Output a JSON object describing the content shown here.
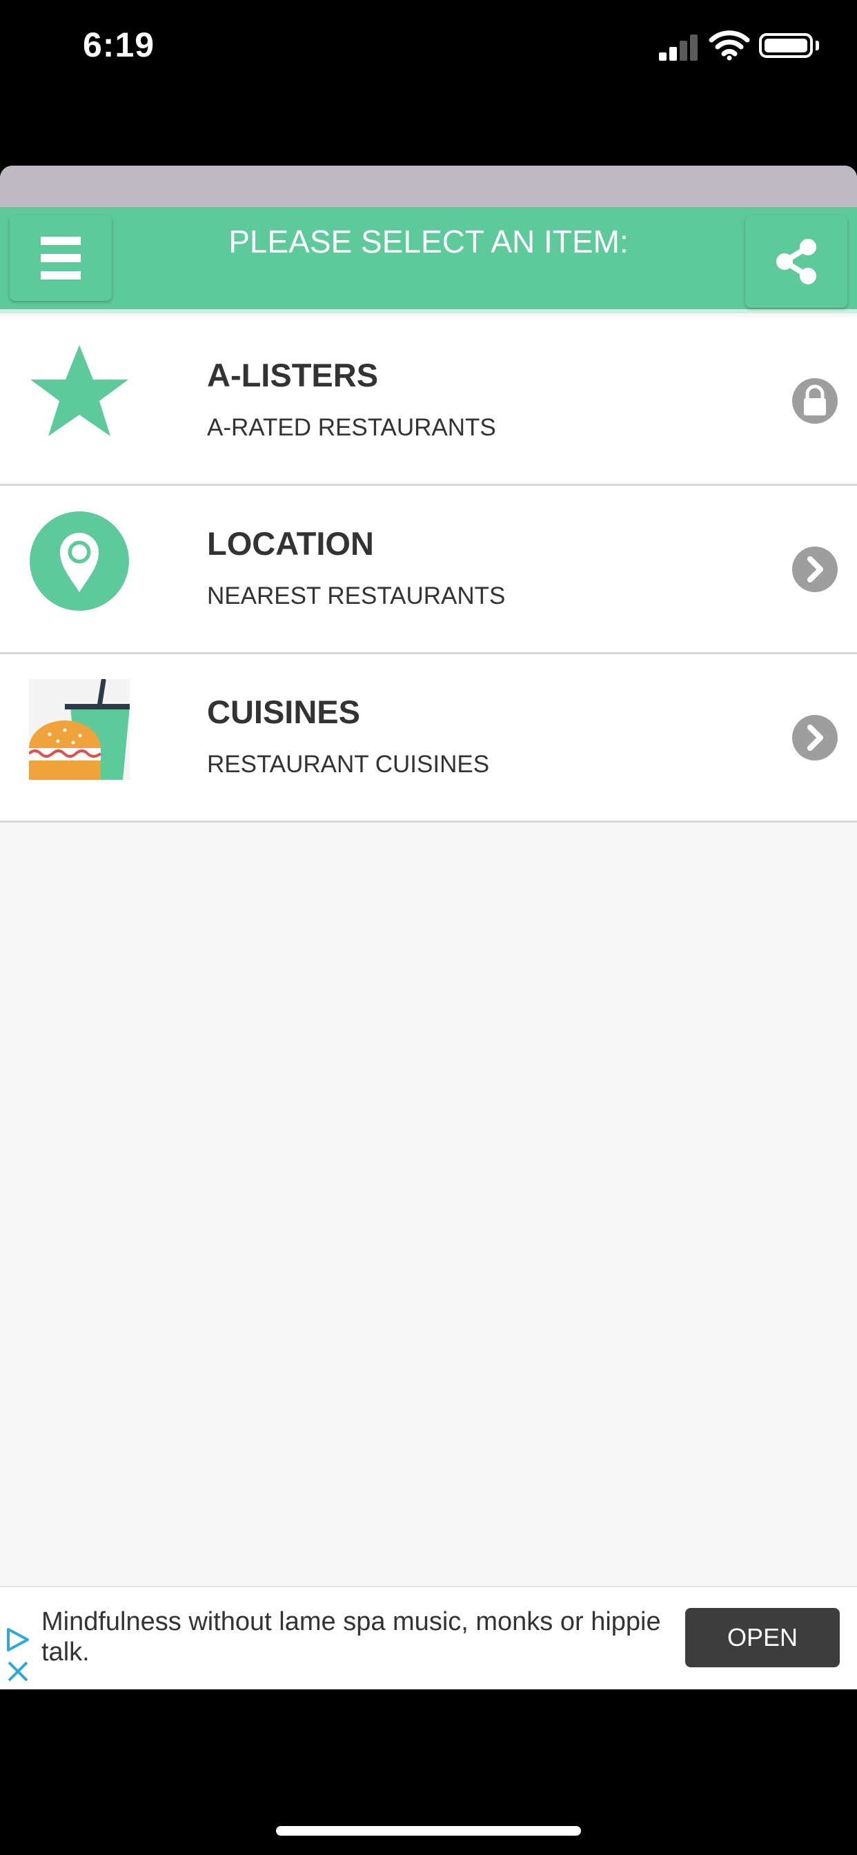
{
  "status_bar": {
    "time": "6:19",
    "icons": [
      "cellular-signal-icon",
      "wifi-icon",
      "battery-icon"
    ]
  },
  "header": {
    "title": "PLEASE SELECT AN ITEM:",
    "menu_icon": "hamburger-menu-icon",
    "share_icon": "share-icon"
  },
  "items": [
    {
      "title": "A-LISTERS",
      "subtitle": "A-RATED RESTAURANTS",
      "icon": "star-icon",
      "action_icon": "lock-icon"
    },
    {
      "title": "LOCATION",
      "subtitle": "NEAREST RESTAURANTS",
      "icon": "map-pin-icon",
      "action_icon": "chevron-right-icon"
    },
    {
      "title": "CUISINES",
      "subtitle": "RESTAURANT CUISINES",
      "icon": "burger-drink-icon",
      "action_icon": "chevron-right-icon"
    }
  ],
  "ad": {
    "text": "Mindfulness without lame spa music, monks or hippie talk.",
    "button_label": "OPEN",
    "icons": [
      "ad-choices-icon",
      "close-icon"
    ]
  },
  "colors": {
    "accent": "#5ec99a",
    "header_strip": "#bdbbc1",
    "text": "#333333",
    "action_icon": "#9e9e9e",
    "ad_button": "#3d3d3d"
  }
}
